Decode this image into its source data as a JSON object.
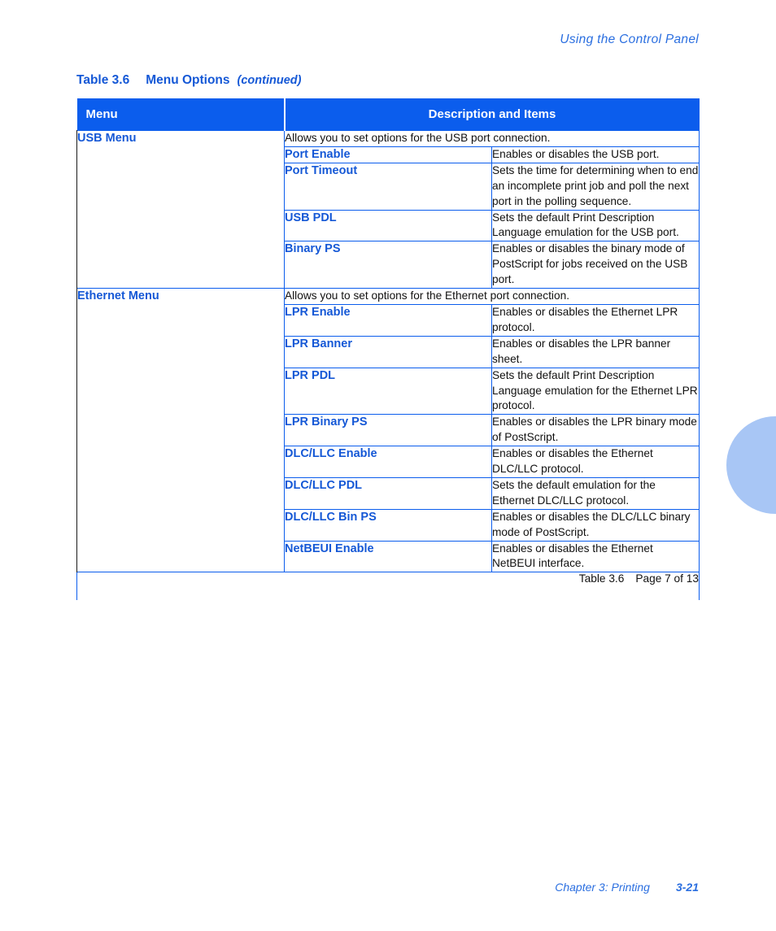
{
  "running_header": "Using the Control Panel",
  "caption": {
    "number": "Table 3.6",
    "title": "Menu Options",
    "continued": "(continued)"
  },
  "table": {
    "columns": [
      "Menu",
      "Description and Items"
    ],
    "groups": [
      {
        "menu": "USB Menu",
        "intro": "Allows you to set options for the USB port connection.",
        "items": [
          {
            "name": "Port Enable",
            "description": "Enables or disables the USB port."
          },
          {
            "name": "Port Timeout",
            "description": "Sets the time for determining when to end an incomplete print job and poll the next port in the polling sequence."
          },
          {
            "name": "USB PDL",
            "description": "Sets the default Print Description Language emulation for the USB port."
          },
          {
            "name": "Binary PS",
            "description": "Enables or disables the binary mode of PostScript for jobs received on the USB port."
          }
        ]
      },
      {
        "menu": "Ethernet Menu",
        "intro": "Allows you to set options for the Ethernet port connection.",
        "items": [
          {
            "name": "LPR Enable",
            "description": "Enables or disables the Ethernet LPR protocol."
          },
          {
            "name": "LPR Banner",
            "description": "Enables or disables the LPR banner sheet."
          },
          {
            "name": "LPR PDL",
            "description": "Sets the default Print Description Language emulation for the Ethernet LPR protocol."
          },
          {
            "name": "LPR Binary PS",
            "description": "Enables or disables the LPR binary mode of PostScript."
          },
          {
            "name": "DLC/LLC Enable",
            "description": "Enables or disables the Ethernet DLC/LLC protocol."
          },
          {
            "name": "DLC/LLC PDL",
            "description": "Sets the default emulation for the Ethernet DLC/LLC protocol."
          },
          {
            "name": "DLC/LLC Bin PS",
            "description": "Enables or disables the DLC/LLC binary mode of PostScript."
          },
          {
            "name": "NetBEUI Enable",
            "description": "Enables or disables the Ethernet NetBEUI interface."
          }
        ]
      }
    ],
    "footer": {
      "table_label": "Table 3.6",
      "page_label": "Page 7 of 13"
    }
  },
  "page_footer": {
    "chapter": "Chapter 3: Printing",
    "folio": "3-21"
  },
  "colors": {
    "header_bar": "#0b5ded",
    "heading_blue": "#1558d6",
    "running_blue": "#2b6fe0",
    "grid_blue": "#0b5ded",
    "edge_tab": "#a8c6f5",
    "body_text": "#111111"
  }
}
